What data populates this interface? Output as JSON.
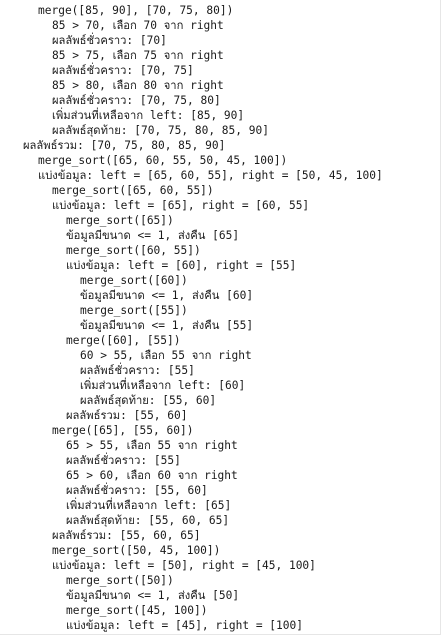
{
  "console": {
    "lines": [
      {
        "indent": "l0",
        "text": "merge([85, 90], [70, 75, 80])"
      },
      {
        "indent": "l1",
        "text": "85 > 70, เลือก 70 จาก right"
      },
      {
        "indent": "l1",
        "text": "ผลลัพธ์ชั่วคราว: [70]"
      },
      {
        "indent": "l1",
        "text": "85 > 75, เลือก 75 จาก right"
      },
      {
        "indent": "l1",
        "text": "ผลลัพธ์ชั่วคราว: [70, 75]"
      },
      {
        "indent": "l1",
        "text": "85 > 80, เลือก 80 จาก right"
      },
      {
        "indent": "l1",
        "text": "ผลลัพธ์ชั่วคราว: [70, 75, 80]"
      },
      {
        "indent": "l1",
        "text": "เพิ่มส่วนที่เหลือจาก left: [85, 90]"
      },
      {
        "indent": "l1",
        "text": "ผลลัพธ์สุดท้าย: [70, 75, 80, 85, 90]"
      },
      {
        "indent": "m1",
        "text": "ผลลัพธ์รวม: [70, 75, 80, 85, 90]"
      },
      {
        "indent": "l0",
        "text": "merge_sort([65, 60, 55, 50, 45, 100])"
      },
      {
        "indent": "l0",
        "text": "แบ่งข้อมูล: left = [65, 60, 55], right = [50, 45, 100]"
      },
      {
        "indent": "l1",
        "text": "merge_sort([65, 60, 55])"
      },
      {
        "indent": "l1",
        "text": "แบ่งข้อมูล: left = [65], right = [60, 55]"
      },
      {
        "indent": "l2",
        "text": "merge_sort([65])"
      },
      {
        "indent": "l2",
        "text": "ข้อมูลมีขนาด <= 1, ส่งคืน [65]"
      },
      {
        "indent": "l2",
        "text": "merge_sort([60, 55])"
      },
      {
        "indent": "l2",
        "text": "แบ่งข้อมูล: left = [60], right = [55]"
      },
      {
        "indent": "l3",
        "text": "merge_sort([60])"
      },
      {
        "indent": "l3",
        "text": "ข้อมูลมีขนาด <= 1, ส่งคืน [60]"
      },
      {
        "indent": "l3",
        "text": "merge_sort([55])"
      },
      {
        "indent": "l3",
        "text": "ข้อมูลมีขนาด <= 1, ส่งคืน [55]"
      },
      {
        "indent": "l2",
        "text": "merge([60], [55])"
      },
      {
        "indent": "l3",
        "text": "60 > 55, เลือก 55 จาก right"
      },
      {
        "indent": "l3",
        "text": "ผลลัพธ์ชั่วคราว: [55]"
      },
      {
        "indent": "l3",
        "text": "เพิ่มส่วนที่เหลือจาก left: [60]"
      },
      {
        "indent": "l3",
        "text": "ผลลัพธ์สุดท้าย: [55, 60]"
      },
      {
        "indent": "l2",
        "text": "ผลลัพธ์รวม: [55, 60]"
      },
      {
        "indent": "l1",
        "text": "merge([65], [55, 60])"
      },
      {
        "indent": "l2",
        "text": "65 > 55, เลือก 55 จาก right"
      },
      {
        "indent": "l2",
        "text": "ผลลัพธ์ชั่วคราว: [55]"
      },
      {
        "indent": "l2",
        "text": "65 > 60, เลือก 60 จาก right"
      },
      {
        "indent": "l2",
        "text": "ผลลัพธ์ชั่วคราว: [55, 60]"
      },
      {
        "indent": "l2",
        "text": "เพิ่มส่วนที่เหลือจาก left: [65]"
      },
      {
        "indent": "l2",
        "text": "ผลลัพธ์สุดท้าย: [55, 60, 65]"
      },
      {
        "indent": "l1",
        "text": "ผลลัพธ์รวม: [55, 60, 65]"
      },
      {
        "indent": "l1",
        "text": "merge_sort([50, 45, 100])"
      },
      {
        "indent": "l1",
        "text": "แบ่งข้อมูล: left = [50], right = [45, 100]"
      },
      {
        "indent": "l2",
        "text": "merge_sort([50])"
      },
      {
        "indent": "l2",
        "text": "ข้อมูลมีขนาด <= 1, ส่งคืน [50]"
      },
      {
        "indent": "l2",
        "text": "merge_sort([45, 100])"
      },
      {
        "indent": "l2",
        "text": "แบ่งข้อมูล: left = [45], right = [100]"
      }
    ]
  }
}
